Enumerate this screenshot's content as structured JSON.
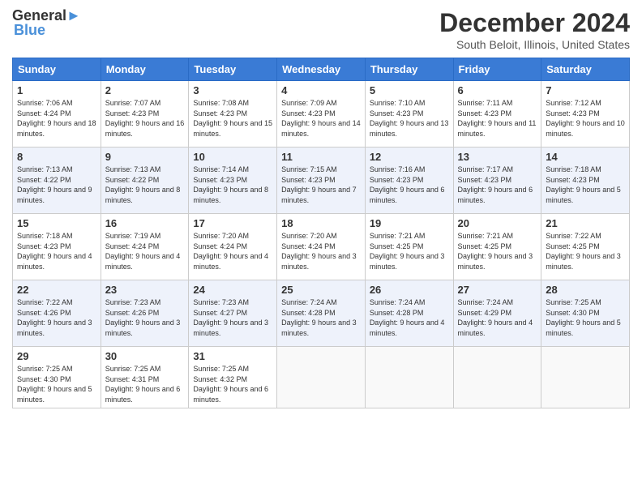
{
  "logo": {
    "line1": "General",
    "line2": "Blue"
  },
  "title": "December 2024",
  "subtitle": "South Beloit, Illinois, United States",
  "days_of_week": [
    "Sunday",
    "Monday",
    "Tuesday",
    "Wednesday",
    "Thursday",
    "Friday",
    "Saturday"
  ],
  "weeks": [
    [
      {
        "day": "1",
        "sunrise": "7:06 AM",
        "sunset": "4:24 PM",
        "daylight": "9 hours and 18 minutes."
      },
      {
        "day": "2",
        "sunrise": "7:07 AM",
        "sunset": "4:23 PM",
        "daylight": "9 hours and 16 minutes."
      },
      {
        "day": "3",
        "sunrise": "7:08 AM",
        "sunset": "4:23 PM",
        "daylight": "9 hours and 15 minutes."
      },
      {
        "day": "4",
        "sunrise": "7:09 AM",
        "sunset": "4:23 PM",
        "daylight": "9 hours and 14 minutes."
      },
      {
        "day": "5",
        "sunrise": "7:10 AM",
        "sunset": "4:23 PM",
        "daylight": "9 hours and 13 minutes."
      },
      {
        "day": "6",
        "sunrise": "7:11 AM",
        "sunset": "4:23 PM",
        "daylight": "9 hours and 11 minutes."
      },
      {
        "day": "7",
        "sunrise": "7:12 AM",
        "sunset": "4:23 PM",
        "daylight": "9 hours and 10 minutes."
      }
    ],
    [
      {
        "day": "8",
        "sunrise": "7:13 AM",
        "sunset": "4:22 PM",
        "daylight": "9 hours and 9 minutes."
      },
      {
        "day": "9",
        "sunrise": "7:13 AM",
        "sunset": "4:22 PM",
        "daylight": "9 hours and 8 minutes."
      },
      {
        "day": "10",
        "sunrise": "7:14 AM",
        "sunset": "4:23 PM",
        "daylight": "9 hours and 8 minutes."
      },
      {
        "day": "11",
        "sunrise": "7:15 AM",
        "sunset": "4:23 PM",
        "daylight": "9 hours and 7 minutes."
      },
      {
        "day": "12",
        "sunrise": "7:16 AM",
        "sunset": "4:23 PM",
        "daylight": "9 hours and 6 minutes."
      },
      {
        "day": "13",
        "sunrise": "7:17 AM",
        "sunset": "4:23 PM",
        "daylight": "9 hours and 6 minutes."
      },
      {
        "day": "14",
        "sunrise": "7:18 AM",
        "sunset": "4:23 PM",
        "daylight": "9 hours and 5 minutes."
      }
    ],
    [
      {
        "day": "15",
        "sunrise": "7:18 AM",
        "sunset": "4:23 PM",
        "daylight": "9 hours and 4 minutes."
      },
      {
        "day": "16",
        "sunrise": "7:19 AM",
        "sunset": "4:24 PM",
        "daylight": "9 hours and 4 minutes."
      },
      {
        "day": "17",
        "sunrise": "7:20 AM",
        "sunset": "4:24 PM",
        "daylight": "9 hours and 4 minutes."
      },
      {
        "day": "18",
        "sunrise": "7:20 AM",
        "sunset": "4:24 PM",
        "daylight": "9 hours and 3 minutes."
      },
      {
        "day": "19",
        "sunrise": "7:21 AM",
        "sunset": "4:25 PM",
        "daylight": "9 hours and 3 minutes."
      },
      {
        "day": "20",
        "sunrise": "7:21 AM",
        "sunset": "4:25 PM",
        "daylight": "9 hours and 3 minutes."
      },
      {
        "day": "21",
        "sunrise": "7:22 AM",
        "sunset": "4:25 PM",
        "daylight": "9 hours and 3 minutes."
      }
    ],
    [
      {
        "day": "22",
        "sunrise": "7:22 AM",
        "sunset": "4:26 PM",
        "daylight": "9 hours and 3 minutes."
      },
      {
        "day": "23",
        "sunrise": "7:23 AM",
        "sunset": "4:26 PM",
        "daylight": "9 hours and 3 minutes."
      },
      {
        "day": "24",
        "sunrise": "7:23 AM",
        "sunset": "4:27 PM",
        "daylight": "9 hours and 3 minutes."
      },
      {
        "day": "25",
        "sunrise": "7:24 AM",
        "sunset": "4:28 PM",
        "daylight": "9 hours and 3 minutes."
      },
      {
        "day": "26",
        "sunrise": "7:24 AM",
        "sunset": "4:28 PM",
        "daylight": "9 hours and 4 minutes."
      },
      {
        "day": "27",
        "sunrise": "7:24 AM",
        "sunset": "4:29 PM",
        "daylight": "9 hours and 4 minutes."
      },
      {
        "day": "28",
        "sunrise": "7:25 AM",
        "sunset": "4:30 PM",
        "daylight": "9 hours and 5 minutes."
      }
    ],
    [
      {
        "day": "29",
        "sunrise": "7:25 AM",
        "sunset": "4:30 PM",
        "daylight": "9 hours and 5 minutes."
      },
      {
        "day": "30",
        "sunrise": "7:25 AM",
        "sunset": "4:31 PM",
        "daylight": "9 hours and 6 minutes."
      },
      {
        "day": "31",
        "sunrise": "7:25 AM",
        "sunset": "4:32 PM",
        "daylight": "9 hours and 6 minutes."
      },
      null,
      null,
      null,
      null
    ]
  ]
}
